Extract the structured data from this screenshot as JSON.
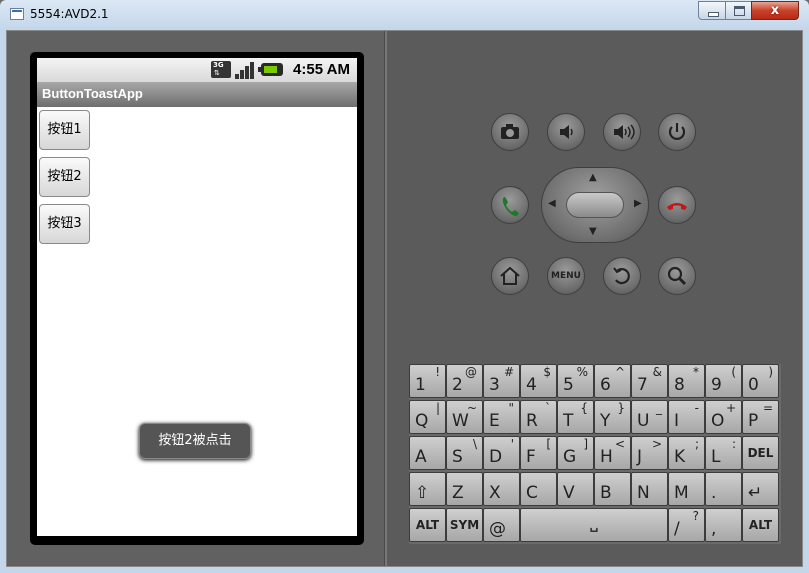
{
  "window": {
    "title": "5554:AVD2.1",
    "close_glyph": "x"
  },
  "statusbar": {
    "time": "4:55 AM",
    "network": "3G"
  },
  "app": {
    "title": "ButtonToastApp",
    "buttons": [
      "按钮1",
      "按钮2",
      "按钮3"
    ],
    "toast": "按钮2被点击"
  },
  "hardware_keys": {
    "menu": "MENU"
  },
  "keyboard": {
    "rows": [
      [
        {
          "m": "1",
          "s": "!"
        },
        {
          "m": "2",
          "s": "@"
        },
        {
          "m": "3",
          "s": "#"
        },
        {
          "m": "4",
          "s": "$"
        },
        {
          "m": "5",
          "s": "%"
        },
        {
          "m": "6",
          "s": "^"
        },
        {
          "m": "7",
          "s": "&"
        },
        {
          "m": "8",
          "s": "*"
        },
        {
          "m": "9",
          "s": "("
        },
        {
          "m": "0",
          "s": ")"
        }
      ],
      [
        {
          "m": "Q",
          "s": "|"
        },
        {
          "m": "W",
          "s": "~"
        },
        {
          "m": "E",
          "s": "\""
        },
        {
          "m": "R",
          "s": "`"
        },
        {
          "m": "T",
          "s": "{"
        },
        {
          "m": "Y",
          "s": "}"
        },
        {
          "m": "U",
          "s": "_"
        },
        {
          "m": "I",
          "s": "-"
        },
        {
          "m": "O",
          "s": "+"
        },
        {
          "m": "P",
          "s": "="
        }
      ],
      [
        {
          "m": "A",
          "s": ""
        },
        {
          "m": "S",
          "s": "\\"
        },
        {
          "m": "D",
          "s": "'"
        },
        {
          "m": "F",
          "s": "["
        },
        {
          "m": "G",
          "s": "]"
        },
        {
          "m": "H",
          "s": "<"
        },
        {
          "m": "J",
          "s": ">"
        },
        {
          "m": "K",
          "s": ";"
        },
        {
          "m": "L",
          "s": ":"
        },
        {
          "m": "",
          "s": "",
          "c": "DEL"
        }
      ],
      [
        {
          "m": "⇧",
          "s": ""
        },
        {
          "m": "Z",
          "s": ""
        },
        {
          "m": "X",
          "s": ""
        },
        {
          "m": "C",
          "s": ""
        },
        {
          "m": "V",
          "s": ""
        },
        {
          "m": "B",
          "s": ""
        },
        {
          "m": "N",
          "s": ""
        },
        {
          "m": "M",
          "s": ""
        },
        {
          "m": ".",
          "s": ""
        },
        {
          "m": "↵",
          "s": ""
        }
      ]
    ],
    "bottom": {
      "alt_left": "ALT",
      "sym": "SYM",
      "at": "@",
      "space": "␣",
      "slash": "/",
      "slash_alt": "?",
      "comma": ",",
      "alt_right": "ALT"
    }
  }
}
